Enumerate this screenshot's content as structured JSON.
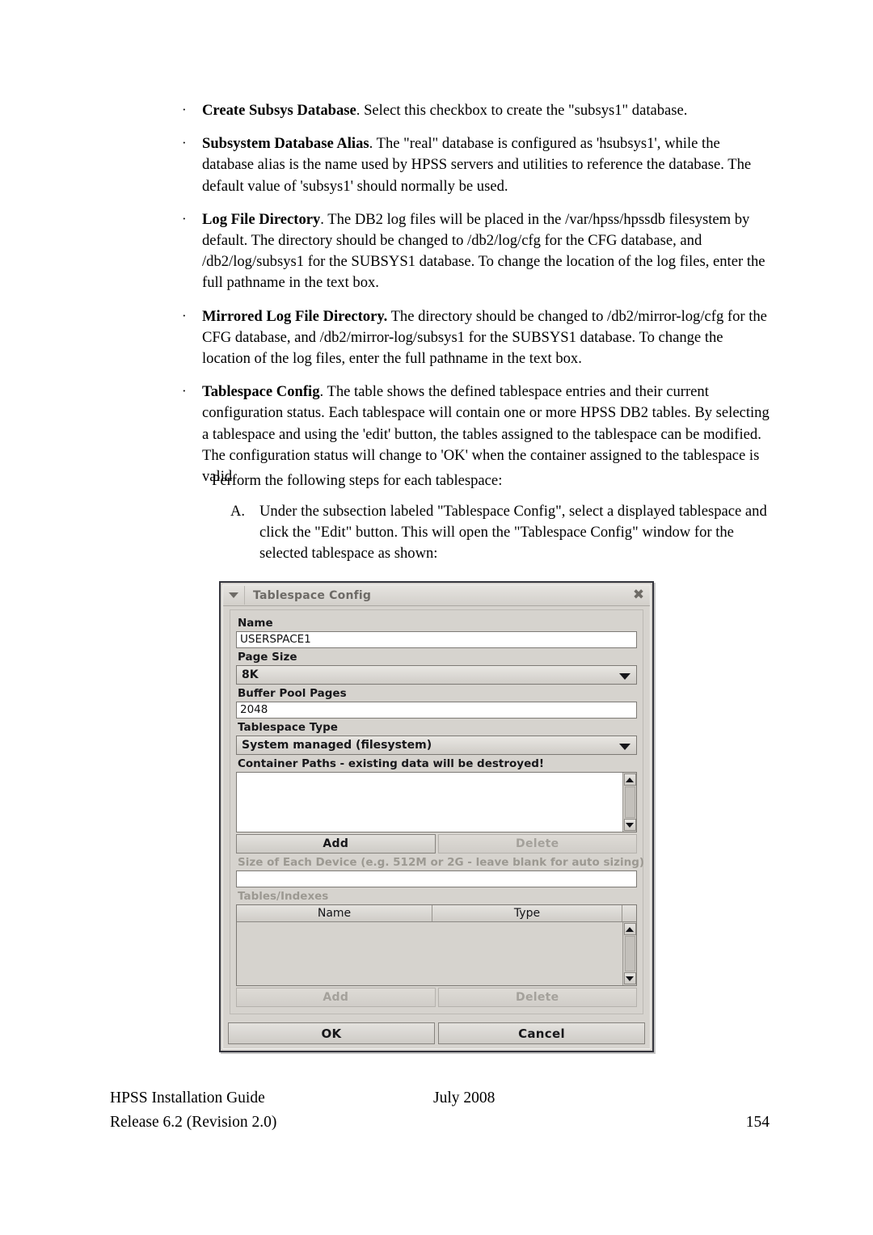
{
  "page": {
    "bullets": [
      {
        "term": "Create Subsys Database",
        "text": ". Select this checkbox to create the \"subsys1\" database."
      },
      {
        "term": "Subsystem Database Alias",
        "text": ". The \"real\" database is configured as 'hsubsys1', while the database alias is the name used by HPSS servers and utilities to reference the database. The default value of 'subsys1' should normally be used."
      },
      {
        "term": "Log File Directory",
        "text": ". The DB2 log files will be placed in the /var/hpss/hpssdb filesystem by default. The directory should be changed to /db2/log/cfg for the CFG database, and /db2/log/subsys1 for the SUBSYS1 database. To change the location of the log files, enter the full pathname in the text box."
      },
      {
        "term": "Mirrored Log File Directory.",
        "text": " The directory should be changed to /db2/mirror-log/cfg for the CFG database, and /db2/mirror-log/subsys1 for the SUBSYS1 database. To change the location of the log files, enter the full pathname in the text box."
      },
      {
        "term": "Tablespace Config",
        "text": ". The table shows the defined tablespace entries and their current configuration status. Each tablespace will contain one or more HPSS DB2 tables. By selecting a tablespace and using the 'edit' button, the tables assigned to the tablespace can be modified. The configuration status will change to 'OK' when the container assigned to the tablespace is valid."
      }
    ],
    "bullet_mark": "·",
    "intro_paragraph": "Perform the following steps for each tablespace:",
    "steps": [
      {
        "marker": "A.",
        "text": "Under the subsection labeled \"Tablespace Config\", select a displayed tablespace and click the \"Edit\" button.  This will open the \"Tablespace Config\" window for the selected tablespace as shown:"
      }
    ]
  },
  "footer": {
    "guide_title": "HPSS Installation Guide",
    "date": "July 2008",
    "release": "Release 6.2 (Revision 2.0)",
    "page_number": "154"
  },
  "dialog": {
    "title": "Tablespace Config",
    "menu_icon": "chevron-down-icon",
    "close_icon": "✖",
    "fields": {
      "name_label": "Name",
      "name_value": "USERSPACE1",
      "page_size_label": "Page Size",
      "page_size_value": "8K",
      "buffer_pool_label": "Buffer Pool Pages",
      "buffer_pool_value": "2048",
      "tablespace_type_label": "Tablespace Type",
      "tablespace_type_value": "System managed (filesystem)",
      "container_paths_label": "Container Paths - existing data will be destroyed!",
      "container_paths_items": [],
      "device_size_label": "Size of Each Device (e.g. 512M or 2G - leave blank for auto sizing)",
      "device_size_value": "",
      "tables_indexes_label": "Tables/Indexes",
      "tables_columns": [
        "Name",
        "Type"
      ],
      "tables_rows": []
    },
    "buttons": {
      "container_add": "Add",
      "container_delete": "Delete",
      "tables_add": "Add",
      "tables_delete": "Delete",
      "ok": "OK",
      "cancel": "Cancel"
    },
    "colors": {
      "window_bg": "#d6d3ce",
      "field_bg": "#ffffff",
      "border": "#34343c",
      "disabled_text": "#a4a19b",
      "title_text": "#6d6a66"
    }
  }
}
